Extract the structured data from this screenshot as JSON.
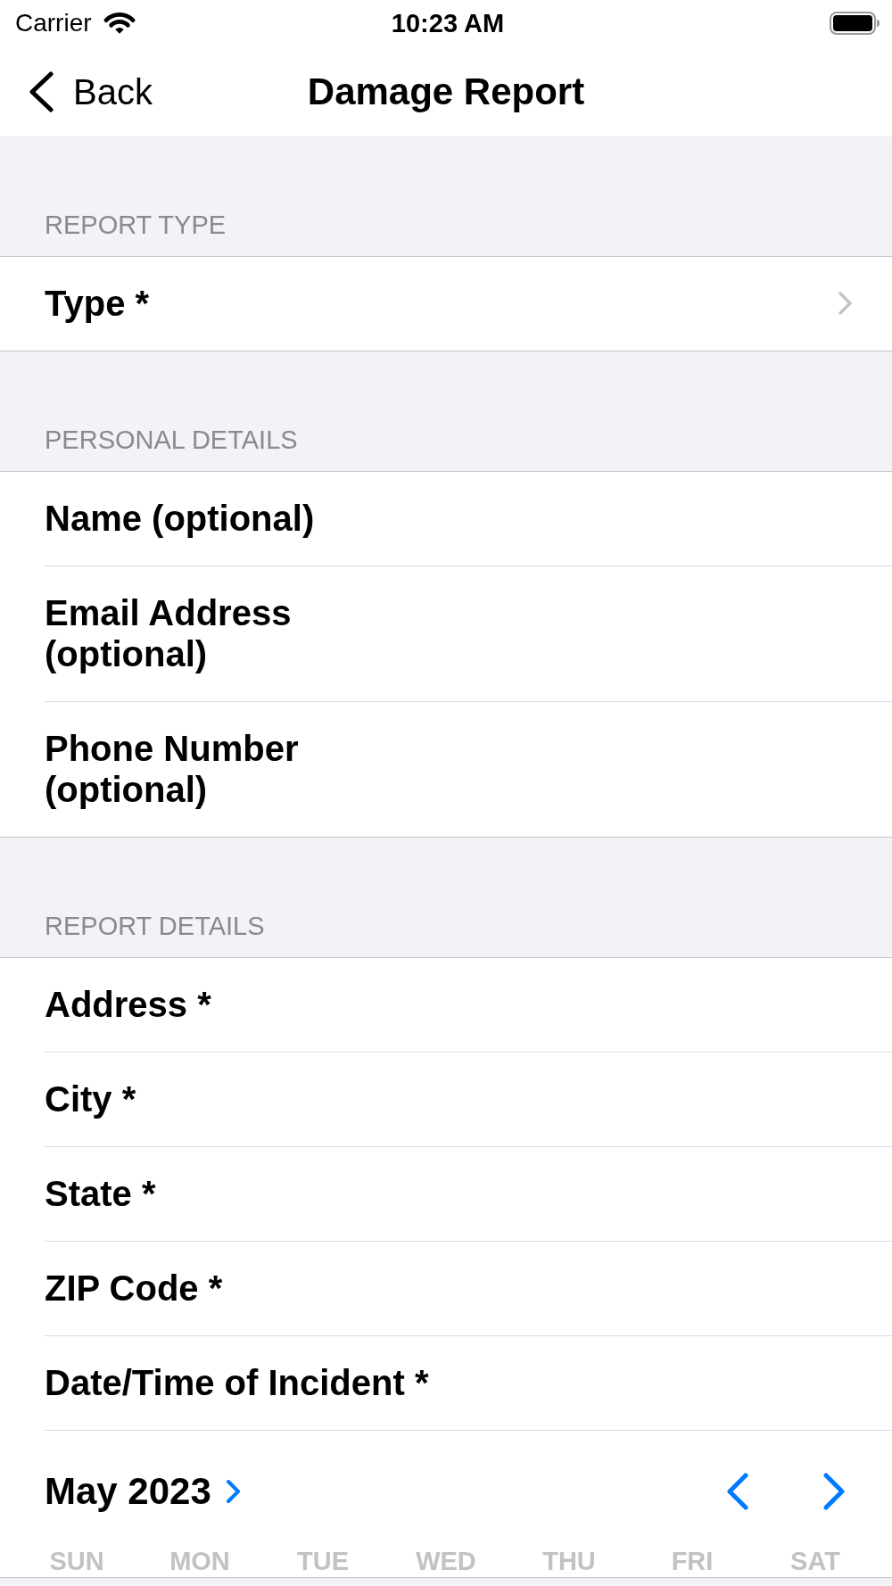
{
  "status_bar": {
    "carrier": "Carrier",
    "time": "10:23 AM"
  },
  "nav_bar": {
    "back": "Back",
    "title": "Damage Report"
  },
  "sections": [
    {
      "header": "REPORT TYPE",
      "rows": [
        {
          "kind": "disclosure",
          "label": "Type *"
        }
      ]
    },
    {
      "header": "PERSONAL DETAILS",
      "rows": [
        {
          "kind": "text",
          "label": "Name (optional)"
        },
        {
          "kind": "text",
          "label": "Email Address (optional)"
        },
        {
          "kind": "text",
          "label": "Phone Number (optional)"
        }
      ]
    },
    {
      "header": "REPORT DETAILS",
      "rows": [
        {
          "kind": "text",
          "label": "Address *"
        },
        {
          "kind": "text",
          "label": "City *"
        },
        {
          "kind": "text",
          "label": "State *"
        },
        {
          "kind": "text",
          "label": "ZIP Code *"
        },
        {
          "kind": "date",
          "label": "Date/Time of Incident *"
        },
        {
          "kind": "calendar",
          "month": "May 2023",
          "weekdays": [
            "SUN",
            "MON",
            "TUE",
            "WED",
            "THU",
            "FRI",
            "SAT"
          ]
        }
      ]
    }
  ]
}
